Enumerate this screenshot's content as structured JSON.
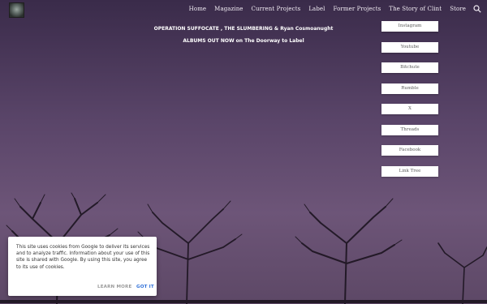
{
  "nav": {
    "items": [
      {
        "label": "Home"
      },
      {
        "label": "Magazine"
      },
      {
        "label": "Current Projects"
      },
      {
        "label": "Label"
      },
      {
        "label": "Former Projects"
      },
      {
        "label": "The Story of Clint"
      },
      {
        "label": "Store"
      }
    ],
    "search_icon": "search-icon"
  },
  "main": {
    "line1": "OPERATION SUFFOCATE , THE SLUMBERING  & Ryan Cosmoanught",
    "line2": "ALBUMS OUT NOW on The Doorway to Label"
  },
  "social_links": [
    {
      "label": "Instagram"
    },
    {
      "label": "Youtube"
    },
    {
      "label": "Bitchute"
    },
    {
      "label": "Rumble"
    },
    {
      "label": "X"
    },
    {
      "label": "Threads"
    },
    {
      "label": "Facebook"
    },
    {
      "label": "Link Tree"
    }
  ],
  "cookie_banner": {
    "text": "This site uses cookies from Google to deliver its services and to analyze traffic. Information about your use of this site is shared with Google. By using this site, you agree to its use of cookies.",
    "learn_more": "LEARN MORE",
    "got_it": "GOT IT"
  },
  "colors": {
    "sky_top": "#3a2b4a",
    "sky_bottom": "#6d5578",
    "accent_link": "#2e6fd8"
  }
}
